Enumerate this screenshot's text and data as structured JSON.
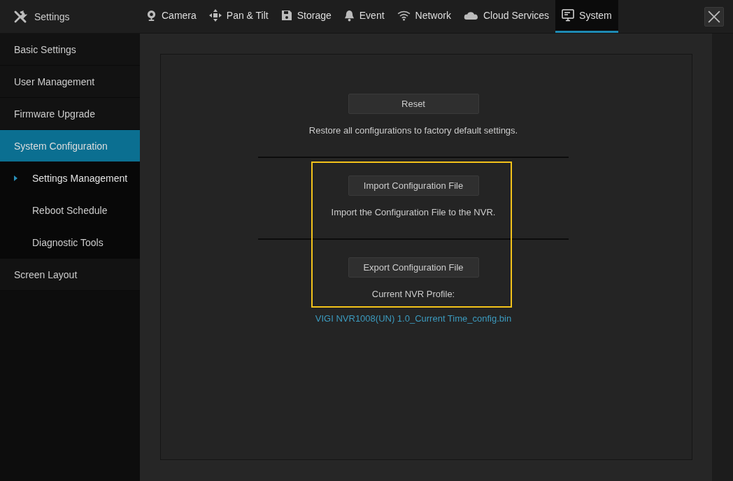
{
  "header": {
    "title": "Settings"
  },
  "tabs": [
    {
      "label": "Camera",
      "selected": false
    },
    {
      "label": "Pan & Tilt",
      "selected": false
    },
    {
      "label": "Storage",
      "selected": false
    },
    {
      "label": "Event",
      "selected": false
    },
    {
      "label": "Network",
      "selected": false
    },
    {
      "label": "Cloud Services",
      "selected": false
    },
    {
      "label": "System",
      "selected": true
    }
  ],
  "sidebar": {
    "items": [
      {
        "label": "Basic Settings",
        "selected": false
      },
      {
        "label": "User Management",
        "selected": false
      },
      {
        "label": "Firmware Upgrade",
        "selected": false
      },
      {
        "label": "System Configuration",
        "selected": true,
        "children": [
          {
            "label": "Settings Management",
            "selected": true
          },
          {
            "label": "Reboot Schedule",
            "selected": false
          },
          {
            "label": "Diagnostic Tools",
            "selected": false
          }
        ]
      },
      {
        "label": "Screen Layout",
        "selected": false
      }
    ]
  },
  "sections": [
    {
      "button": "Reset",
      "description": "Restore all configurations to factory default settings."
    },
    {
      "button": "Import Configuration File",
      "description": "Import the Configuration File to the NVR."
    },
    {
      "button": "Export Configuration File",
      "description": "Current NVR Profile:",
      "file": "VIGI NVR1008(UN) 1.0_Current Time_config.bin"
    }
  ]
}
